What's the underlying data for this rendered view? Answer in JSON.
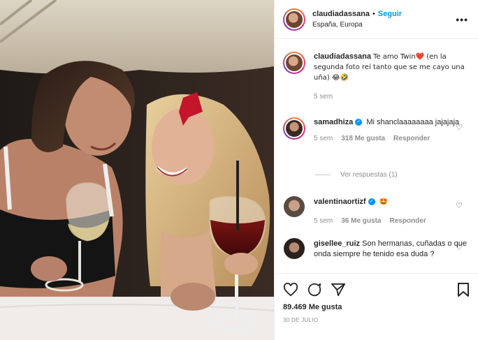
{
  "post": {
    "username": "claudiadassana",
    "follow_label": "Seguir",
    "dot": "•",
    "location": "España, Europa",
    "more_label": "•••"
  },
  "caption": {
    "username": "claudiadassana",
    "text": "Te amo Twin❤️ (en la segunda foto reí tanto que se me cayo una uña) 😂🤣",
    "time": "5 sem"
  },
  "comments": [
    {
      "username": "samadhiza",
      "verified": true,
      "text": "Mi shanclaaaaaaaa jajajaja",
      "time": "5 sem",
      "likes": "318 Me gusta",
      "reply_label": "Responder"
    },
    {
      "username": "valentinaortizf",
      "verified": true,
      "text": "🤩",
      "time": "5 sem",
      "likes": "36 Me gusta",
      "reply_label": "Responder"
    },
    {
      "username": "gisellee_ruiz",
      "verified": false,
      "text": "Son hermanas, cuñadas o que onda siempre he tenido esa duda ?",
      "time": "",
      "likes": "",
      "reply_label": ""
    }
  ],
  "view_replies": "Ver respuestas (1)",
  "footer": {
    "likes": "89.469 Me gusta",
    "date": "30 DE JULIO"
  },
  "colors": {
    "accent": "#0095f6",
    "meta": "#8e8e8e",
    "heart": "#ed4956"
  },
  "icons": [
    "heart-icon",
    "comment-icon",
    "share-icon",
    "bookmark-icon",
    "more-icon",
    "verified-icon"
  ]
}
